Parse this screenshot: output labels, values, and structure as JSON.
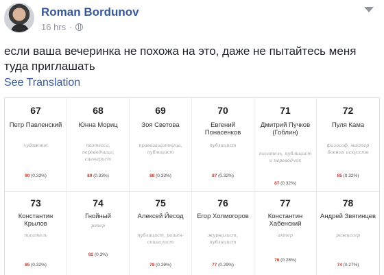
{
  "post": {
    "author": "Roman Bordunov",
    "time": "16 hrs",
    "separator": "·",
    "text": "если ваша вечеринка не похожа на это, даже не пытайтесь меня туда приглашать",
    "see_translation": "See Translation"
  },
  "ranking_rows": [
    [
      {
        "rank": "67",
        "name": "Петр Павленский",
        "role": "художник",
        "points": "90",
        "percent": "(0.33%)"
      },
      {
        "rank": "68",
        "name": "Юнна Мориц",
        "role": "поэтесса, переводчица, сценарист",
        "points": "89",
        "percent": "(0.33%)"
      },
      {
        "rank": "69",
        "name": "Зоя Светова",
        "role": "правозащитница, публицист",
        "points": "88",
        "percent": "(0.33%)"
      },
      {
        "rank": "70",
        "name": "Евгений Понасенков",
        "role": "публицист",
        "points": "87",
        "percent": "(0.32%)"
      },
      {
        "rank": "71",
        "name": "Дмитрий Пучков (Гоблин)",
        "role": "писатель, публицист и переводчик",
        "points": "87",
        "percent": "(0.32%)"
      },
      {
        "rank": "72",
        "name": "Пуля Кама",
        "role": "философ, мастер боевых искусств",
        "points": "85",
        "percent": "(0.32%)"
      }
    ],
    [
      {
        "rank": "73",
        "name": "Константин Крылов",
        "role": "писатель",
        "points": "85",
        "percent": "(0.32%)"
      },
      {
        "rank": "74",
        "name": "Гнойный",
        "role": "рэпер",
        "points": "82",
        "percent": "(0.3%)"
      },
      {
        "rank": "75",
        "name": "Алексей Йесод",
        "role": "публицист, рашен-социалист",
        "points": "78",
        "percent": "(0.29%)"
      },
      {
        "rank": "76",
        "name": "Егор Холмогоров",
        "role": "журналист, публицист",
        "points": "77",
        "percent": "(0.29%)"
      },
      {
        "rank": "77",
        "name": "Константин Хабенский",
        "role": "актер",
        "points": "76",
        "percent": "(0.28%)"
      },
      {
        "rank": "78",
        "name": "Андрей Звягинцев",
        "role": "режиссер",
        "points": "74",
        "percent": "(0.27%)"
      }
    ]
  ],
  "icons": {
    "avatar": "profile-photo",
    "privacy": "globe-icon",
    "menu": "chevron-down-icon"
  },
  "colors": {
    "link": "#365899",
    "meta": "#90949c",
    "points": "#c0392b"
  }
}
